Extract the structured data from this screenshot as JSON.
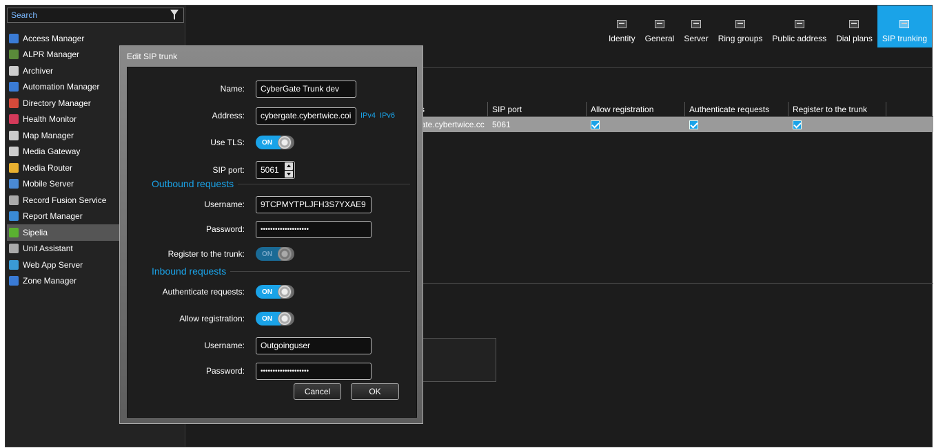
{
  "search": {
    "placeholder": "Search"
  },
  "sidebar": {
    "items": [
      {
        "label": "Access Manager",
        "icon": "access-manager-icon",
        "color": "#3a7bd5"
      },
      {
        "label": "ALPR Manager",
        "icon": "alpr-manager-icon",
        "color": "#5a8a3a"
      },
      {
        "label": "Archiver",
        "icon": "archiver-icon",
        "color": "#cccccc"
      },
      {
        "label": "Automation Manager",
        "icon": "automation-manager-icon",
        "color": "#3a7bd5"
      },
      {
        "label": "Directory Manager",
        "icon": "directory-manager-icon",
        "color": "#d54a3a"
      },
      {
        "label": "Health Monitor",
        "icon": "health-monitor-icon",
        "color": "#d53a5a"
      },
      {
        "label": "Map Manager",
        "icon": "map-manager-icon",
        "color": "#cccccc"
      },
      {
        "label": "Media Gateway",
        "icon": "media-gateway-icon",
        "color": "#cccccc"
      },
      {
        "label": "Media Router",
        "icon": "media-router-icon",
        "color": "#e8b030"
      },
      {
        "label": "Mobile Server",
        "icon": "mobile-server-icon",
        "color": "#4a8ad5"
      },
      {
        "label": "Record Fusion Service",
        "icon": "record-fusion-icon",
        "color": "#aaaaaa"
      },
      {
        "label": "Report Manager",
        "icon": "report-manager-icon",
        "color": "#3a8ad5"
      },
      {
        "label": "Sipelia",
        "icon": "sipelia-icon",
        "color": "#5ab030"
      },
      {
        "label": "Unit Assistant",
        "icon": "unit-assistant-icon",
        "color": "#aaaaaa"
      },
      {
        "label": "Web App Server",
        "icon": "web-app-server-icon",
        "color": "#3a9ad5"
      },
      {
        "label": "Zone Manager",
        "icon": "zone-manager-icon",
        "color": "#3a7bd5"
      }
    ],
    "selected": "Sipelia"
  },
  "tabs": [
    {
      "label": "Identity"
    },
    {
      "label": "General"
    },
    {
      "label": "Server"
    },
    {
      "label": "Ring groups"
    },
    {
      "label": "Public address"
    },
    {
      "label": "Dial plans"
    },
    {
      "label": "SIP trunking",
      "active": true
    }
  ],
  "table": {
    "headers": [
      "ss",
      "SIP port",
      "Allow registration",
      "Authenticate requests",
      "Register to the trunk"
    ],
    "row": {
      "address": "gate.cybertwice.cc",
      "sip_port": "5061"
    }
  },
  "dialog": {
    "title": "Edit SIP trunk",
    "name_label": "Name:",
    "name_value": "CyberGate Trunk dev",
    "address_label": "Address:",
    "address_value": "cybergate.cybertwice.coi",
    "ipv4": "IPv4",
    "ipv6": "IPv6",
    "use_tls_label": "Use TLS:",
    "toggle_on": "ON",
    "sip_port_label": "SIP port:",
    "sip_port_value": "5061",
    "outbound_title": "Outbound requests",
    "out_username_label": "Username:",
    "out_username_value": "9TCPMYTPLJFH3S7YXAE9",
    "out_password_label": "Password:",
    "out_password_value": "••••••••••••••••••••",
    "register_label": "Register to the trunk:",
    "inbound_title": "Inbound requests",
    "auth_label": "Authenticate requests:",
    "allow_reg_label": "Allow registration:",
    "in_username_label": "Username:",
    "in_username_value": "Outgoinguser",
    "in_password_label": "Password:",
    "in_password_value": "••••••••••••••••••••",
    "cancel": "Cancel",
    "ok": "OK"
  },
  "colors": {
    "accent": "#1aa3e8",
    "background": "#1c1c1c",
    "selected_row": "#9a9a9a"
  }
}
